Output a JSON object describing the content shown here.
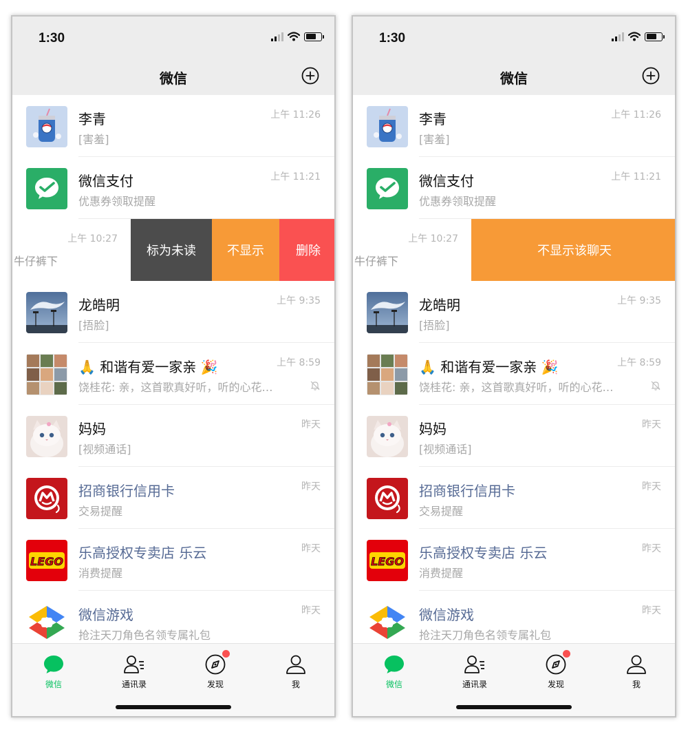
{
  "colors": {
    "brand_green": "#07c160",
    "official_name": "#576b95",
    "mark_unread_bg": "#4c4c4c",
    "hide_bg": "#f79a37",
    "delete_bg": "#fa5151"
  },
  "status_bar": {
    "time": "1:30",
    "icons": [
      "signal-icon",
      "wifi-icon",
      "battery-icon"
    ]
  },
  "nav": {
    "title": "微信",
    "add_icon": "plus-circle-icon"
  },
  "chats": [
    {
      "name": "李青",
      "preview": "[害羞]",
      "time": "上午 11:26"
    },
    {
      "name": "微信支付",
      "preview": "优惠券领取提醒",
      "time": "上午 11:21"
    },
    {
      "name": "牛仔裤下",
      "preview": "",
      "time": "上午 10:27"
    },
    {
      "name": "龙皓明",
      "preview": "[捂脸]",
      "time": "上午 9:35"
    },
    {
      "name": "🙏 和谐有爱一家亲 🎉",
      "preview": "饶桂花: 亲，这首歌真好听，听的心花…",
      "time": "上午 8:59",
      "muted": true
    },
    {
      "name": "妈妈",
      "preview": "[视频通话]",
      "time": "昨天"
    },
    {
      "name": "招商银行信用卡",
      "preview": "交易提醒",
      "time": "昨天"
    },
    {
      "name": "乐高授权专卖店 乐云",
      "preview": "消费提醒",
      "time": "昨天"
    },
    {
      "name": "微信游戏",
      "preview": "抢注天刀角色名领专属礼包",
      "time": "昨天"
    }
  ],
  "swipe_left": {
    "mark_unread": "标为未读",
    "hide": "不显示",
    "delete": "删除"
  },
  "swipe_right": {
    "hide_chat": "不显示该聊天"
  },
  "tabs": [
    {
      "label": "微信",
      "icon": "chat-bubble-icon",
      "active": true
    },
    {
      "label": "通讯录",
      "icon": "contacts-icon"
    },
    {
      "label": "发现",
      "icon": "compass-icon",
      "badge": true
    },
    {
      "label": "我",
      "icon": "person-icon"
    }
  ],
  "logos": {
    "lego": "LEGO"
  }
}
